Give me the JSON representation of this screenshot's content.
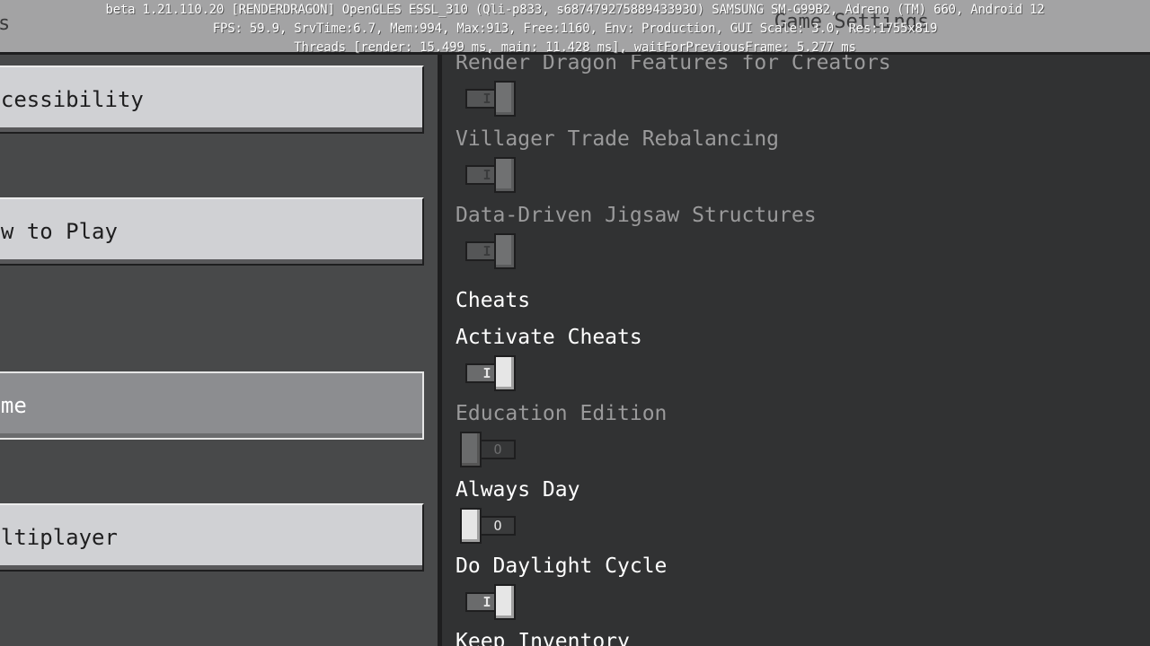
{
  "debug": {
    "line1": "beta 1.21.110.20 [RENDERDRAGON] OpenGLES ESSL_310 (Qli-p833, s68747927588943393O) SAMSUNG SM-G99B2, Adreno (TM) 660, Android 12",
    "line2": "FPS: 59.9, SrvTime:6.7, Mem:994, Max:913, Free:1160, Env: Production, GUI Scale: 3.0, Res:1755x819",
    "line3": "Threads [render: 15.499 ms, main: 11.428 ms], waitForPreviousFrame: 5.277 ms"
  },
  "header": {
    "left_title": "s",
    "title": "Game Settings"
  },
  "nav": {
    "accessibility": "Accessibility",
    "how_to_play": "How to Play",
    "game": "Game",
    "multiplayer": "Multiplayer"
  },
  "settings": {
    "render_dragon": {
      "label": "Render Dragon Features for Creators",
      "on": true,
      "enabled": false
    },
    "villager_trade": {
      "label": "Villager Trade Rebalancing",
      "on": true,
      "enabled": false
    },
    "jigsaw": {
      "label": "Data-Driven Jigsaw Structures",
      "on": true,
      "enabled": false
    },
    "cheats_heading": "Cheats",
    "activate_cheats": {
      "label": "Activate Cheats",
      "on": true,
      "enabled": true
    },
    "education_edition": {
      "label": "Education Edition",
      "on": false,
      "enabled": false
    },
    "always_day": {
      "label": "Always Day",
      "on": false,
      "enabled": true
    },
    "daylight_cycle": {
      "label": "Do Daylight Cycle",
      "on": true,
      "enabled": true
    },
    "keep_inventory": {
      "label": "Keep Inventory"
    }
  },
  "toggle_marks": {
    "on": "I",
    "off": "O"
  }
}
